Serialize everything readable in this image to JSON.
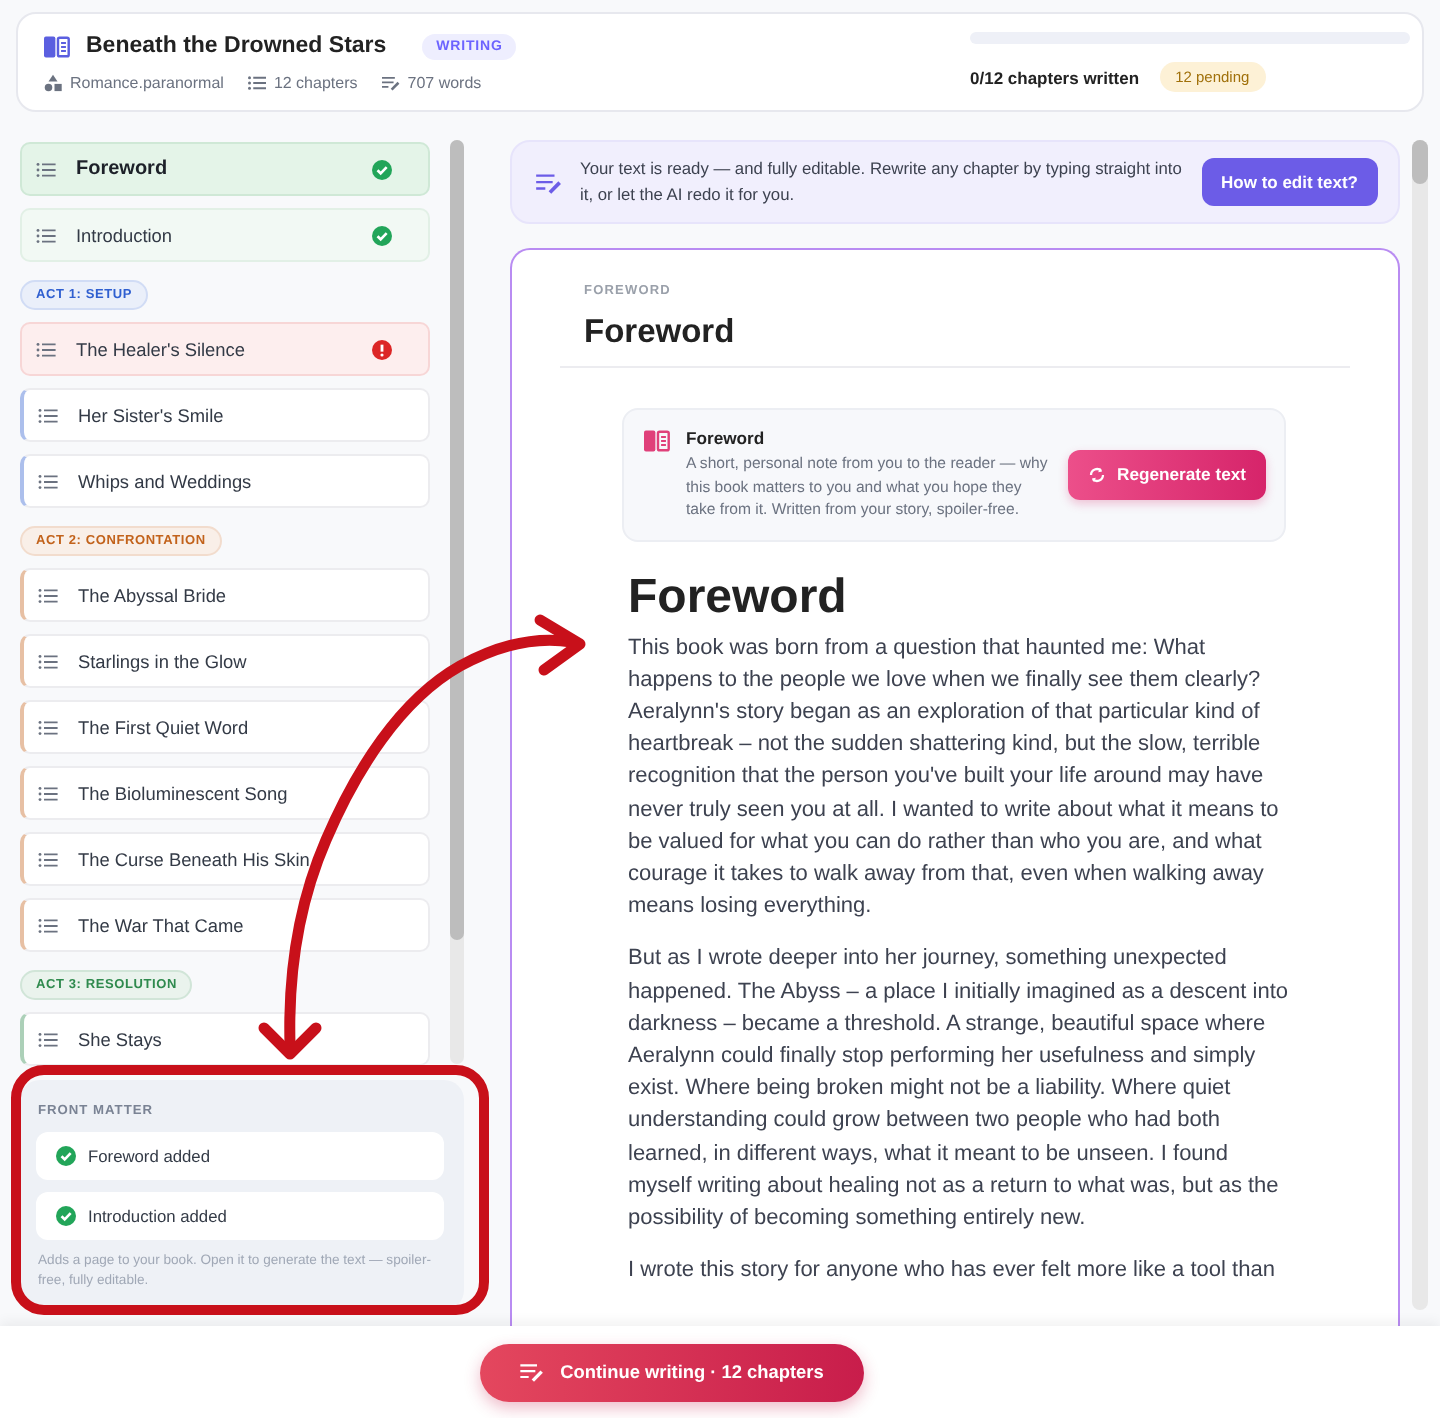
{
  "header": {
    "title": "Beneath the Drowned Stars",
    "status_badge": "WRITING",
    "meta": [
      {
        "kind": "genre",
        "text": "Romance.paranormal"
      },
      {
        "kind": "chapters",
        "text": "12 chapters"
      },
      {
        "kind": "words",
        "text": "707 words"
      }
    ],
    "progress": {
      "level": 0,
      "label": "0/12 chapters written",
      "pending_badge": "12 pending"
    }
  },
  "sidebar": {
    "groups": [
      {
        "items": [
          {
            "title": "Foreword",
            "selected": true,
            "complete": true,
            "error": false
          },
          {
            "title": "Introduction",
            "selected": false,
            "complete": true,
            "error": false
          }
        ]
      },
      {
        "act": {
          "label": "ACT 1: SETUP",
          "color": "#2f5fd0"
        },
        "items": [
          {
            "title": "The Healer's Silence",
            "selected": false,
            "complete": false,
            "error": true
          },
          {
            "title": "Her Sister's Smile",
            "selected": false,
            "complete": false,
            "error": false
          },
          {
            "title": "Whips and Weddings",
            "selected": false,
            "complete": false,
            "error": false
          }
        ]
      },
      {
        "act": {
          "label": "ACT 2: CONFRONTATION",
          "color": "#c2621b"
        },
        "items": [
          {
            "title": "The Abyssal Bride",
            "selected": false,
            "complete": false,
            "error": false
          },
          {
            "title": "Starlings in the Glow",
            "selected": false,
            "complete": false,
            "error": false
          },
          {
            "title": "The First Quiet Word",
            "selected": false,
            "complete": false,
            "error": false
          },
          {
            "title": "The Bioluminescent Song",
            "selected": false,
            "complete": false,
            "error": false
          },
          {
            "title": "The Curse Beneath His Skin",
            "selected": false,
            "complete": false,
            "error": false
          },
          {
            "title": "The War That Came",
            "selected": false,
            "complete": false,
            "error": false
          }
        ]
      },
      {
        "act": {
          "label": "ACT 3: RESOLUTION",
          "color": "#2f8a4e"
        },
        "items": [
          {
            "title": "She Stays",
            "selected": false,
            "complete": false,
            "error": false
          }
        ]
      }
    ],
    "front_matter": {
      "title": "FRONT MATTER",
      "items": [
        {
          "label": "Foreword added",
          "added": true
        },
        {
          "label": "Introduction added",
          "added": true
        }
      ],
      "note": "Adds a page to your book. Open it to generate the text — spoiler-free, fully editable."
    }
  },
  "banner": {
    "text": "Your text is ready — and fully editable. Rewrite any chapter by typing straight into it, or let the AI redo it for you.",
    "button": "How to edit text?"
  },
  "editor": {
    "eyebrow": "FOREWORD",
    "title": "Foreword",
    "note_card": {
      "title": "Foreword",
      "description": "A short, personal note from you to the reader — why this book matters to you and what you hope they take from it. Written from your story, spoiler-free.",
      "button": "Regenerate text"
    },
    "heading": "Foreword",
    "paragraphs": [
      "This book was born from a question that haunted me: What happens to the people we love when we finally see them clearly? Aeralynn's story began as an exploration of that particular kind of heartbreak – not the sudden shattering kind, but the slow, terrible recognition that the person you've built your life around may have never truly seen you at all. I wanted to write about what it means to be valued for what you can do rather than who you are, and what courage it takes to walk away from that, even when walking away means losing everything.",
      "But as I wrote deeper into her journey, something unexpected happened. The Abyss – a place I initially imagined as a descent into darkness – became a threshold. A strange, beautiful space where Aeralynn could finally stop performing her usefulness and simply exist. Where being broken might not be a liability. Where quiet understanding could grow between two people who had both learned, in different ways, what it meant to be unseen. I found myself writing about healing not as a return to what was, but as the possibility of becoming something entirely new.",
      "I wrote this story for anyone who has ever felt more like a tool than"
    ]
  },
  "footer": {
    "button": "Continue writing · 12 chapters"
  }
}
